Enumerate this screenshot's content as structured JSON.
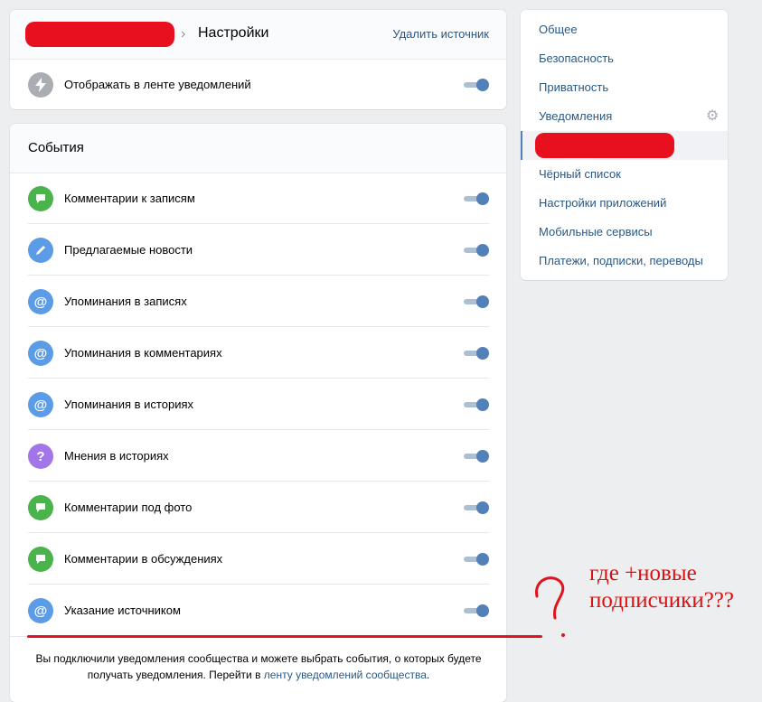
{
  "header": {
    "title": "Настройки",
    "delete_link": "Удалить источник",
    "feed_toggle_label": "Отображать в ленте уведомлений",
    "feed_toggle_on": true
  },
  "events": {
    "title": "События",
    "items": [
      {
        "label": "Комментарии к записям",
        "icon": "comment-icon",
        "color": "#4bb34b",
        "on": true
      },
      {
        "label": "Предлагаемые новости",
        "icon": "pencil-icon",
        "color": "#5c9ce6",
        "on": true
      },
      {
        "label": "Упоминания в записях",
        "icon": "at-icon",
        "color": "#5c9ce6",
        "on": true
      },
      {
        "label": "Упоминания в комментариях",
        "icon": "at-icon",
        "color": "#5c9ce6",
        "on": true
      },
      {
        "label": "Упоминания в историях",
        "icon": "at-icon",
        "color": "#5c9ce6",
        "on": true
      },
      {
        "label": "Мнения в историях",
        "icon": "question-icon",
        "color": "#a275e8",
        "on": true
      },
      {
        "label": "Комментарии под фото",
        "icon": "comment-icon",
        "color": "#4bb34b",
        "on": true
      },
      {
        "label": "Комментарии в обсуждениях",
        "icon": "comment-icon",
        "color": "#4bb34b",
        "on": true
      },
      {
        "label": "Указание источником",
        "icon": "at-icon",
        "color": "#5c9ce6",
        "on": true
      }
    ],
    "footer_text": "Вы подключили уведомления сообщества и можете выбрать события, о которых будете получать уведомления. Перейти в",
    "footer_link": "ленту уведомлений сообщества",
    "footer_end": "."
  },
  "nav": {
    "items": [
      {
        "label": "Общее"
      },
      {
        "label": "Безопасность"
      },
      {
        "label": "Приватность"
      },
      {
        "label": "Уведомления"
      },
      {
        "label": ""
      },
      {
        "label": "Чёрный список"
      },
      {
        "label": "Настройки приложений"
      },
      {
        "label": "Мобильные сервисы"
      },
      {
        "label": "Платежи, подписки, переводы"
      }
    ]
  },
  "annotation": {
    "line1": "где +новые",
    "line2": "подписчики???"
  },
  "colors": {
    "accent": "#5181b8",
    "link": "#2a5885",
    "annotation_red": "#e0141e"
  }
}
